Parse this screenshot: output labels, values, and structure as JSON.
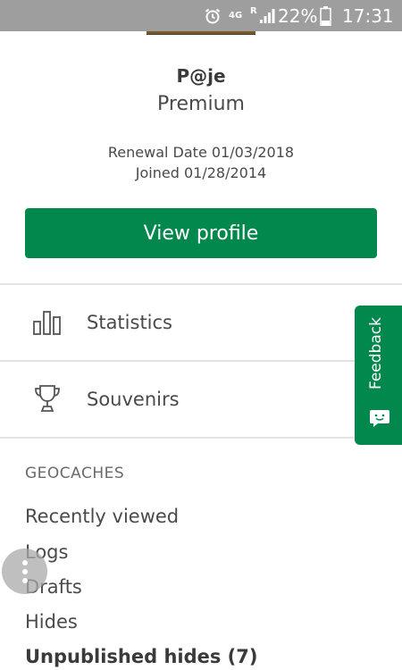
{
  "status_bar": {
    "network_label": "4G",
    "roaming_label": "R",
    "battery_percent": "22%",
    "time": "17:31",
    "alarm_icon": "alarm-clock-icon",
    "signal_icon": "signal-bars-icon",
    "battery_icon": "battery-icon"
  },
  "profile": {
    "username": "P@je",
    "membership": "Premium",
    "renewal_date": "Renewal Date 01/03/2018",
    "joined_date": "Joined 01/28/2014",
    "view_profile_label": "View profile"
  },
  "menu": {
    "items": [
      {
        "label": "Statistics",
        "icon": "bar-chart-icon"
      },
      {
        "label": "Souvenirs",
        "icon": "trophy-icon"
      }
    ]
  },
  "geocaches": {
    "header": "GEOCACHES",
    "items": [
      {
        "label": "Recently viewed"
      },
      {
        "label": "Logs"
      },
      {
        "label": "Drafts"
      },
      {
        "label": "Hides"
      },
      {
        "label": "Unpublished hides (7)"
      }
    ]
  },
  "feedback": {
    "label": "Feedback",
    "icon": "chat-smile-icon"
  },
  "colors": {
    "brand_green": "#02874d",
    "status_bar": "#9e9e9e",
    "divider": "#e2e2e2"
  }
}
